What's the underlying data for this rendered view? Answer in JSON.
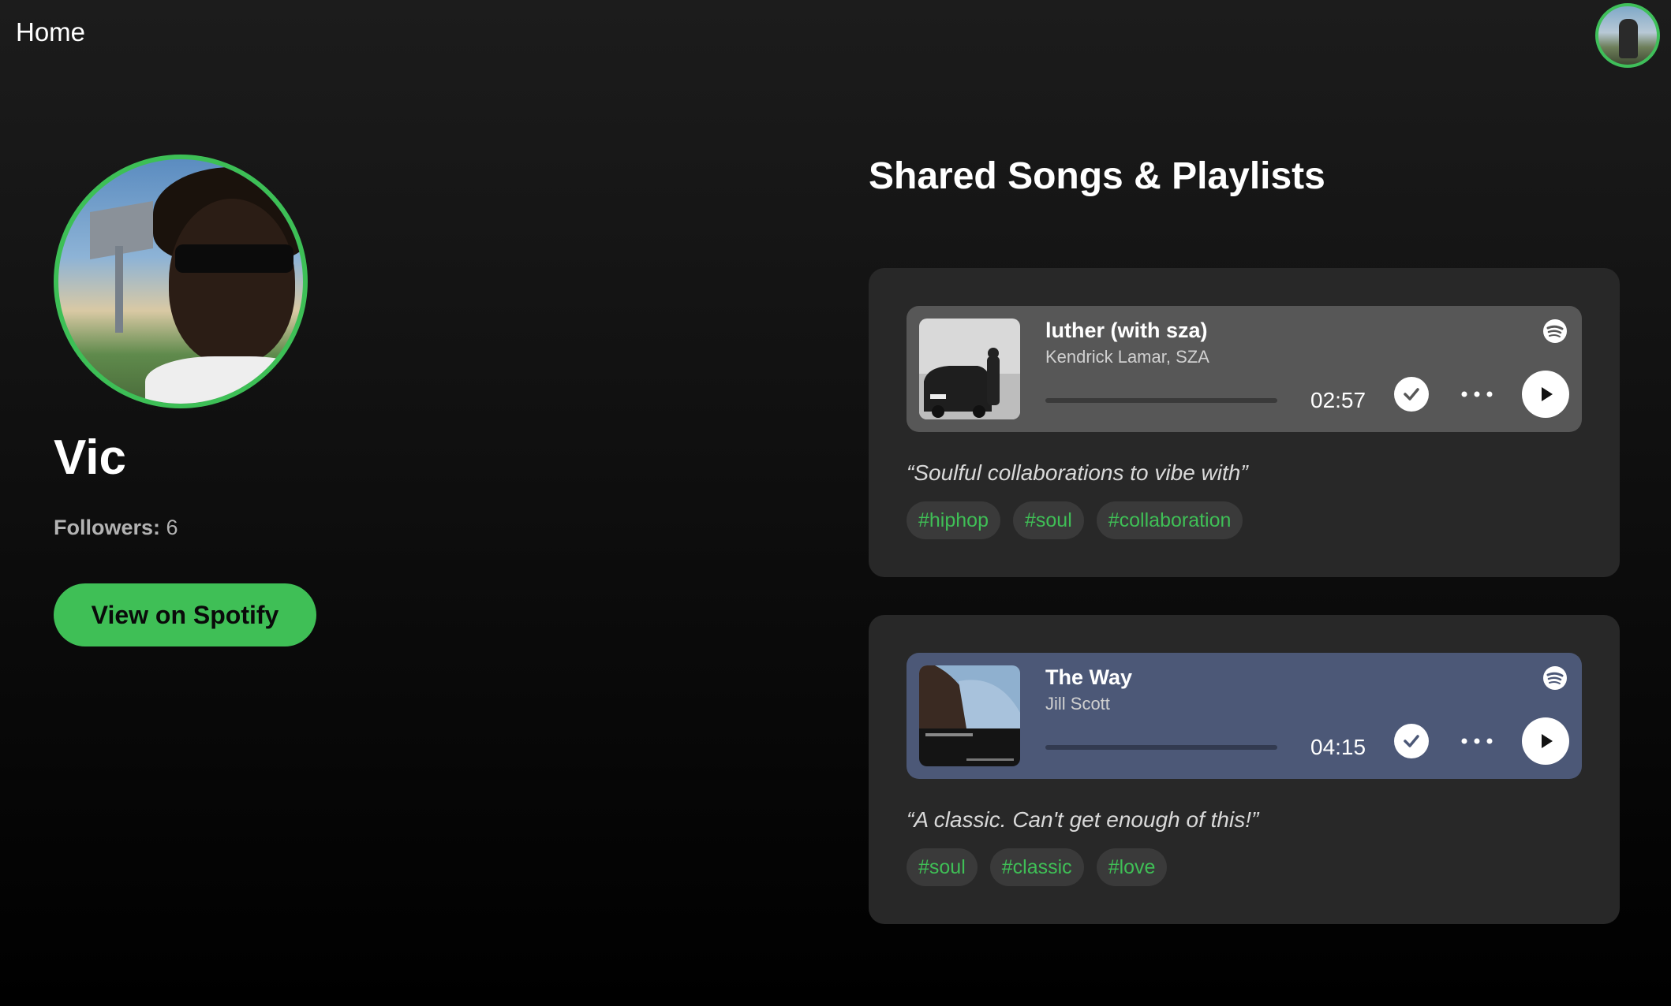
{
  "nav": {
    "home_label": "Home"
  },
  "profile": {
    "name": "Vic",
    "followers_label": "Followers:",
    "followers_count": "6",
    "spotify_button_label": "View on Spotify"
  },
  "section": {
    "title": "Shared Songs & Playlists"
  },
  "shares": [
    {
      "track_title": "luther (with sza)",
      "artist": "Kendrick Lamar, SZA",
      "duration": "02:57",
      "player_color": "#575757",
      "quote": "“Soulful collaborations to vibe with”",
      "tags": [
        "#hiphop",
        "#soul",
        "#collaboration"
      ]
    },
    {
      "track_title": "The Way",
      "artist": "Jill Scott",
      "duration": "04:15",
      "player_color": "#4c5877",
      "quote": "“A classic. Can't get enough of this!”",
      "tags": [
        "#soul",
        "#classic",
        "#love"
      ]
    }
  ],
  "colors": {
    "accent": "#3fbf56",
    "card_bg": "#282828",
    "tag_bg": "#3a3a3a"
  },
  "icons": [
    "spotify-icon",
    "check-icon",
    "more-icon",
    "play-icon"
  ]
}
